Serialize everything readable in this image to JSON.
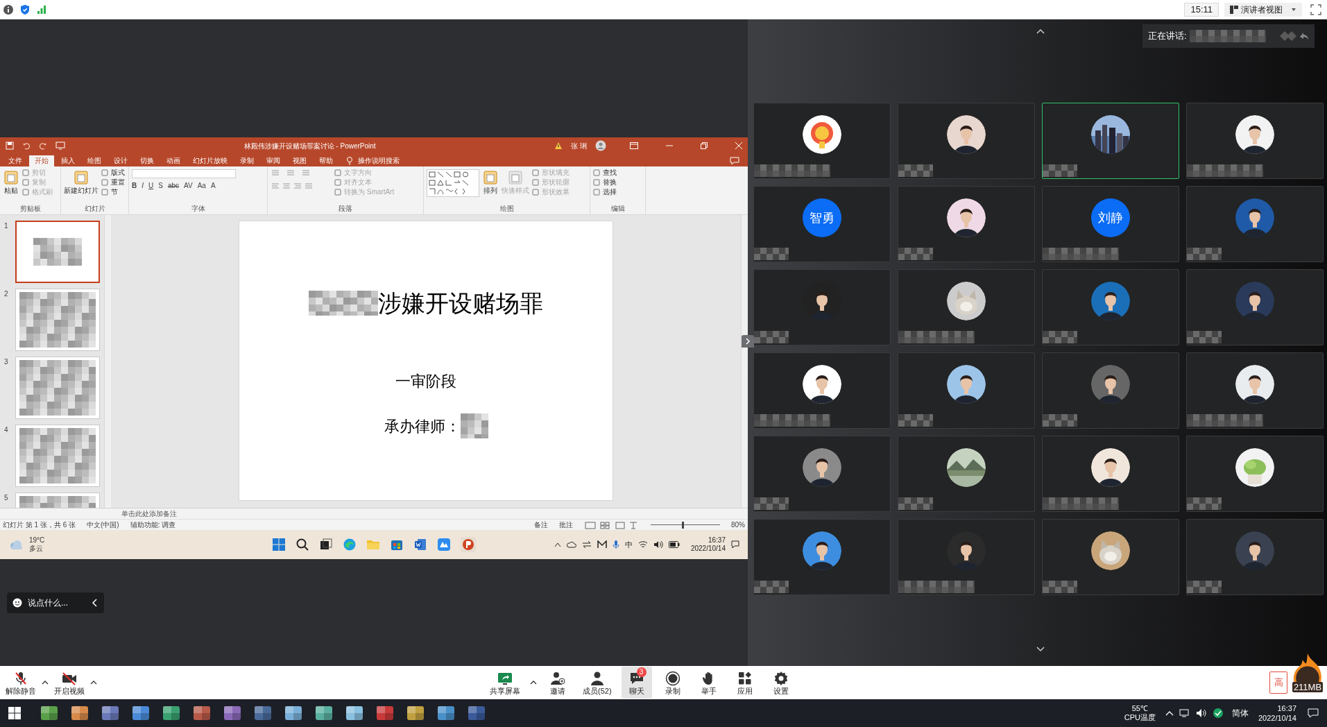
{
  "top_bar": {
    "timer": "15:11",
    "view_button": "演讲者视图"
  },
  "speaker_banner": {
    "label": "正在讲话:"
  },
  "powerpoint": {
    "title": "林殿伟涉嫌开设赌场罪案讨论 - PowerPoint",
    "user": "张 琍",
    "tabs": [
      {
        "label": "文件",
        "selected": false
      },
      {
        "label": "开始",
        "selected": true
      },
      {
        "label": "插入",
        "selected": false
      },
      {
        "label": "绘图",
        "selected": false
      },
      {
        "label": "设计",
        "selected": false
      },
      {
        "label": "切换",
        "selected": false
      },
      {
        "label": "动画",
        "selected": false
      },
      {
        "label": "幻灯片放映",
        "selected": false
      },
      {
        "label": "录制",
        "selected": false
      },
      {
        "label": "审阅",
        "selected": false
      },
      {
        "label": "视图",
        "selected": false
      },
      {
        "label": "帮助",
        "selected": false
      }
    ],
    "search": "操作说明搜索",
    "ribbon_groups": [
      {
        "name": "剪贴板",
        "large": [
          {
            "label": "粘贴",
            "disabled": false
          }
        ],
        "small": [
          {
            "label": "剪切",
            "disabled": true
          },
          {
            "label": "复制",
            "disabled": true
          },
          {
            "label": "格式刷",
            "disabled": true
          }
        ]
      },
      {
        "name": "幻灯片",
        "large": [
          {
            "label": "新建幻灯片",
            "disabled": false
          }
        ],
        "small": [
          {
            "label": "版式",
            "disabled": false
          },
          {
            "label": "重置",
            "disabled": false
          },
          {
            "label": "节",
            "disabled": false
          }
        ]
      },
      {
        "name": "字体",
        "glyphs": [
          "B",
          "I",
          "U",
          "S",
          "abc",
          "AV",
          "Aa",
          "A"
        ]
      },
      {
        "name": "段落",
        "small": [
          {
            "label": "文字方向",
            "disabled": true
          },
          {
            "label": "对齐文本",
            "disabled": true
          },
          {
            "label": "转换为 SmartArt",
            "disabled": true
          }
        ]
      },
      {
        "name": "绘图",
        "large": [
          {
            "label": "排列",
            "disabled": false
          },
          {
            "label": "快速样式",
            "disabled": true
          }
        ],
        "small": [
          {
            "label": "形状填充",
            "disabled": true
          },
          {
            "label": "形状轮廓",
            "disabled": true
          },
          {
            "label": "形状效果",
            "disabled": true
          }
        ]
      },
      {
        "name": "编辑",
        "small": [
          {
            "label": "查找",
            "disabled": false
          },
          {
            "label": "替换",
            "disabled": false
          },
          {
            "label": "选择",
            "disabled": false
          }
        ]
      }
    ],
    "thumbnails": [
      {
        "number": "1",
        "selected": true
      },
      {
        "number": "2",
        "selected": false
      },
      {
        "number": "3",
        "selected": false
      },
      {
        "number": "4",
        "selected": false
      },
      {
        "number": "5",
        "selected": false
      }
    ],
    "slide": {
      "title": "涉嫌开设赌场罪",
      "subtitle": "一审阶段",
      "lawyer_label": "承办律师："
    },
    "notes_placeholder": "单击此处添加备注",
    "status_bar": {
      "slide_info": "幻灯片 第 1 张，共 6 张",
      "language": "中文(中国)",
      "accessibility": "辅助功能: 调查",
      "notes": "备注",
      "comments": "批注",
      "level": 0.45,
      "zoom": "80%"
    },
    "taskbar": {
      "temperature": "19°C",
      "weather": "多云",
      "ime": "中",
      "time": "16:37",
      "date": "2022/10/14"
    }
  },
  "chat_input": {
    "label": "说点什么..."
  },
  "participants": [
    {
      "kind": "picture",
      "speaking": false
    },
    {
      "kind": "picture",
      "speaking": false
    },
    {
      "kind": "picture",
      "speaking": true
    },
    {
      "kind": "picture",
      "speaking": false
    },
    {
      "kind": "initials",
      "initials": "智勇",
      "speaking": false
    },
    {
      "kind": "picture",
      "speaking": false
    },
    {
      "kind": "initials",
      "initials": "刘静",
      "speaking": false
    },
    {
      "kind": "picture",
      "speaking": false
    },
    {
      "kind": "picture",
      "speaking": false
    },
    {
      "kind": "picture",
      "speaking": false
    },
    {
      "kind": "picture",
      "speaking": false
    },
    {
      "kind": "picture",
      "speaking": false
    },
    {
      "kind": "picture",
      "speaking": false
    },
    {
      "kind": "picture",
      "speaking": false
    },
    {
      "kind": "picture",
      "speaking": false
    },
    {
      "kind": "picture",
      "speaking": false
    },
    {
      "kind": "picture",
      "speaking": false
    },
    {
      "kind": "picture",
      "speaking": false
    },
    {
      "kind": "picture",
      "speaking": false
    },
    {
      "kind": "picture",
      "speaking": false
    },
    {
      "kind": "picture",
      "speaking": false
    },
    {
      "kind": "picture",
      "speaking": false
    },
    {
      "kind": "picture",
      "speaking": false
    },
    {
      "kind": "picture",
      "speaking": false
    }
  ],
  "toolbar": {
    "left": [
      {
        "kind": "mic",
        "label": "解除静音"
      },
      {
        "kind": "video",
        "label": "开启视频"
      }
    ],
    "center": [
      {
        "kind": "share",
        "label": "共享屏幕",
        "selected": false
      },
      {
        "kind": "invite",
        "label": "邀请",
        "selected": false
      },
      {
        "kind": "members",
        "label": "成员(52)",
        "selected": false
      },
      {
        "kind": "chat",
        "label": "聊天",
        "badge": "3",
        "selected": true
      },
      {
        "kind": "record",
        "label": "录制",
        "selected": false
      },
      {
        "kind": "hand",
        "label": "举手",
        "selected": false
      },
      {
        "kind": "apps",
        "label": "应用",
        "selected": false
      },
      {
        "kind": "settings",
        "label": "设置",
        "selected": false
      }
    ],
    "quality_button": "高",
    "memory": "211MB"
  },
  "system_taskbar": {
    "temperature": "55℃",
    "cpu_label": "CPU温度",
    "ime": "简体",
    "time": "16:37",
    "date": "2022/10/14"
  }
}
